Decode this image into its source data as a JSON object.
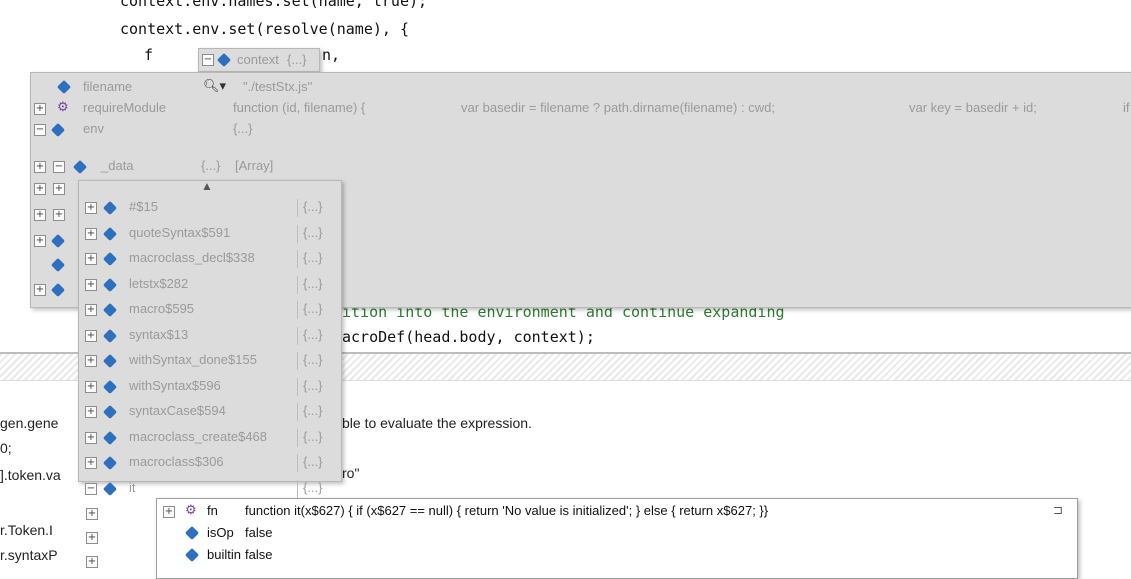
{
  "editor": {
    "lines": [
      "context.env.names.set(name, true);",
      "context.env.set(resolve(name), {"
    ],
    "line3_prefix": "f",
    "line3_suffix": "n,",
    "comment_line": "ition into the environment and continue expanding",
    "code_line": "acroDef(head.body, context);"
  },
  "context_tip": {
    "name": "context",
    "value": "{...}",
    "pin": "⊐"
  },
  "context_popup": {
    "rows": [
      {
        "name": "filename",
        "value": "\"./testStx.js\"",
        "search": true
      },
      {
        "name": "requireModule",
        "value": "function (id, filename) {",
        "extra": "var basedir = filename ? path.dirname(filename) : cwd;",
        "extra2": "var key = basedir + id;",
        "extra3": "if"
      },
      {
        "name": "env",
        "value": "{...}"
      },
      {
        "name": "_data",
        "value": "{...}",
        "type": "[Array]"
      }
    ]
  },
  "data_popup": {
    "scroll_up": "▲",
    "items": [
      {
        "name": "#$15",
        "value": "{...}"
      },
      {
        "name": "quoteSyntax$591",
        "value": "{...}"
      },
      {
        "name": "macroclass_decl$338",
        "value": "{...}"
      },
      {
        "name": "letstx$282",
        "value": "{...}"
      },
      {
        "name": "macro$595",
        "value": "{...}"
      },
      {
        "name": "syntax$13",
        "value": "{...}"
      },
      {
        "name": "withSyntax_done$155",
        "value": "{...}"
      },
      {
        "name": "withSyntax$596",
        "value": "{...}"
      },
      {
        "name": "syntaxCase$594",
        "value": "{...}"
      },
      {
        "name": "macroclass_create$468",
        "value": "{...}"
      },
      {
        "name": "macroclass$306",
        "value": "{...}"
      },
      {
        "name": "it",
        "value": "{...}"
      }
    ]
  },
  "it_popup": {
    "rows": [
      {
        "name": "fn",
        "value": "function it(x$627) {   if (x$627 == null) {       return 'No value is initialized';   } else {       return x$627;   }}"
      },
      {
        "name": "isOp",
        "value": "false"
      },
      {
        "name": "builtin",
        "value": "false"
      }
    ],
    "pin": "⊐"
  },
  "lower": {
    "left_lines": [
      "gen.gene",
      "0;",
      "].token.va",
      "r.Token.I",
      "r.syntaxP"
    ],
    "message": "ble to evaluate the expression.",
    "quote_fragment": "ro\""
  }
}
